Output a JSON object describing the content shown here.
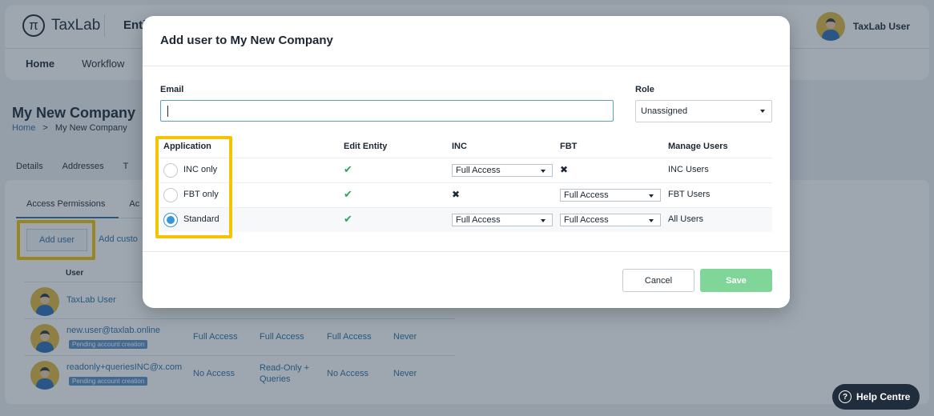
{
  "app": {
    "logo_text": "TaxLab",
    "logo_glyph": "π",
    "entity_title": "Enti",
    "user_name": "TaxLab User"
  },
  "nav": {
    "home": "Home",
    "workflow": "Workflow"
  },
  "page": {
    "company_title": "My New Company",
    "breadcrumb": {
      "home": "Home",
      "sep": ">",
      "current": "My New Company"
    },
    "tabs": [
      "Details",
      "Addresses",
      "T"
    ],
    "subtabs": [
      "Access Permissions",
      "Ac"
    ],
    "add_user_label": "Add user",
    "add_custom_label": "Add custo",
    "users_header": "User",
    "users": [
      {
        "email": "TaxLab User",
        "badge": "",
        "c1": "",
        "c2": "",
        "c3": "",
        "c4": ""
      },
      {
        "email": "new.user@taxlab.online",
        "badge": "Pending account creation",
        "c1": "Full Access",
        "c2": "Full Access",
        "c3": "Full Access",
        "c4": "Never"
      },
      {
        "email": "readonly+queriesINC@x.com",
        "badge": "Pending account creation",
        "c1": "No Access",
        "c2": "Read-Only + Queries",
        "c3": "No Access",
        "c4": "Never"
      }
    ]
  },
  "help": {
    "label": "Help Centre",
    "glyph": "?"
  },
  "modal": {
    "title": "Add user to My New Company",
    "email_label": "Email",
    "email_value": "",
    "role_label": "Role",
    "role_value": "Unassigned",
    "headers": {
      "application": "Application",
      "edit_entity": "Edit Entity",
      "inc": "INC",
      "fbt": "FBT",
      "manage_users": "Manage Users"
    },
    "rows": [
      {
        "label": "INC only",
        "selected": false,
        "inc": "Full Access",
        "fbt": "✖",
        "manage": "INC Users"
      },
      {
        "label": "FBT only",
        "selected": false,
        "inc": "✖",
        "fbt": "Full Access",
        "manage": "FBT Users"
      },
      {
        "label": "Standard",
        "selected": true,
        "inc": "Full Access",
        "fbt": "Full Access",
        "manage": "All Users"
      }
    ],
    "check_glyph": "✔",
    "cancel_label": "Cancel",
    "save_label": "Save"
  },
  "colors": {
    "accent": "#2b6ea3",
    "highlight": "#f5c400",
    "save": "#7fd698",
    "check": "#2aa65b"
  },
  "icons": {
    "logo": "taxlab-logo-icon",
    "avatar": "user-avatar-icon",
    "check": "check-icon",
    "cross": "cross-icon",
    "help": "help-icon",
    "dropdown": "chevron-down-icon"
  }
}
